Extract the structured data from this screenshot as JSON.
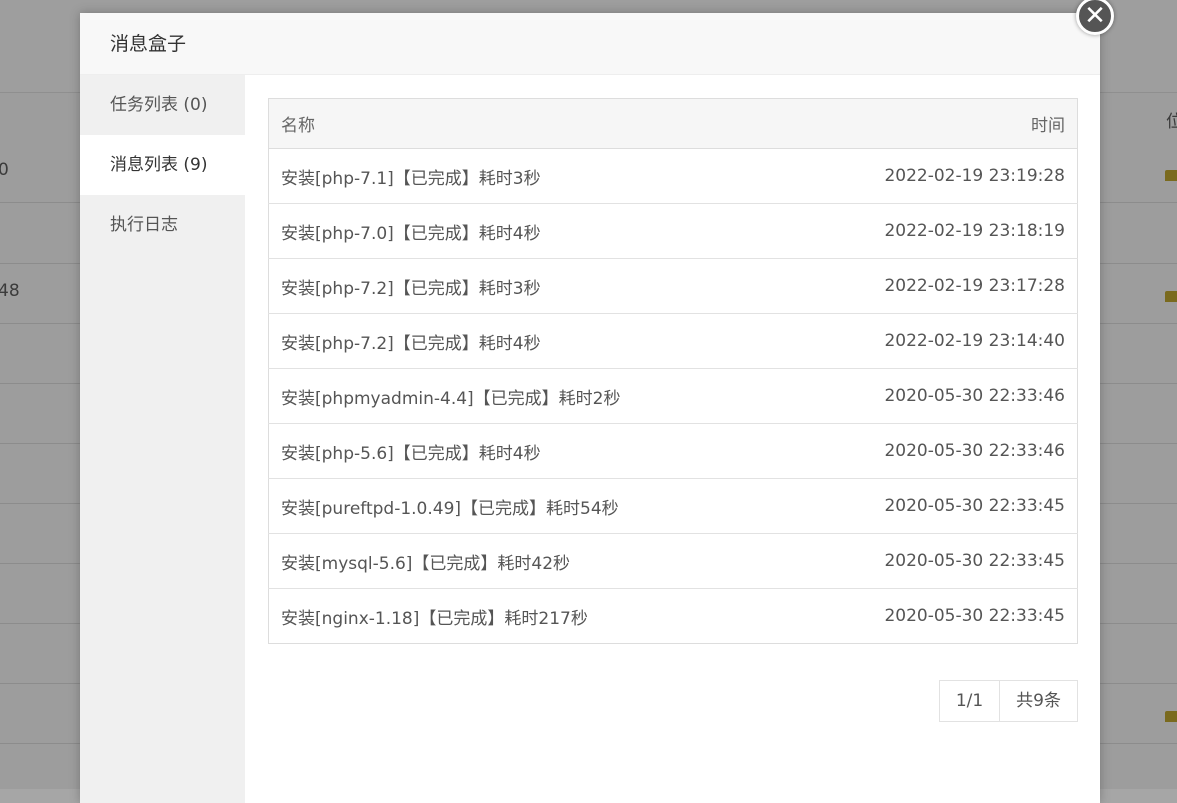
{
  "background": {
    "row_texts_left": [
      "0",
      "48"
    ],
    "header_right": "位"
  },
  "dialog": {
    "title": "消息盒子",
    "close_icon": "close-icon",
    "sidebar": {
      "items": [
        {
          "label": "任务列表 (0)",
          "active": false
        },
        {
          "label": "消息列表 (9)",
          "active": true
        },
        {
          "label": "执行日志",
          "active": false
        }
      ]
    },
    "table": {
      "headers": {
        "name": "名称",
        "time": "时间"
      },
      "rows": [
        {
          "name": "安装[php-7.1]【已完成】耗时3秒",
          "time": "2022-02-19 23:19:28"
        },
        {
          "name": "安装[php-7.0]【已完成】耗时4秒",
          "time": "2022-02-19 23:18:19"
        },
        {
          "name": "安装[php-7.2]【已完成】耗时3秒",
          "time": "2022-02-19 23:17:28"
        },
        {
          "name": "安装[php-7.2]【已完成】耗时4秒",
          "time": "2022-02-19 23:14:40"
        },
        {
          "name": "安装[phpmyadmin-4.4]【已完成】耗时2秒",
          "time": "2020-05-30 22:33:46"
        },
        {
          "name": "安装[php-5.6]【已完成】耗时4秒",
          "time": "2020-05-30 22:33:46"
        },
        {
          "name": "安装[pureftpd-1.0.49]【已完成】耗时54秒",
          "time": "2020-05-30 22:33:45"
        },
        {
          "name": "安装[mysql-5.6]【已完成】耗时42秒",
          "time": "2020-05-30 22:33:45"
        },
        {
          "name": "安装[nginx-1.18]【已完成】耗时217秒",
          "time": "2020-05-30 22:33:45"
        }
      ]
    },
    "pager": {
      "page": "1/1",
      "total": "共9条"
    }
  }
}
